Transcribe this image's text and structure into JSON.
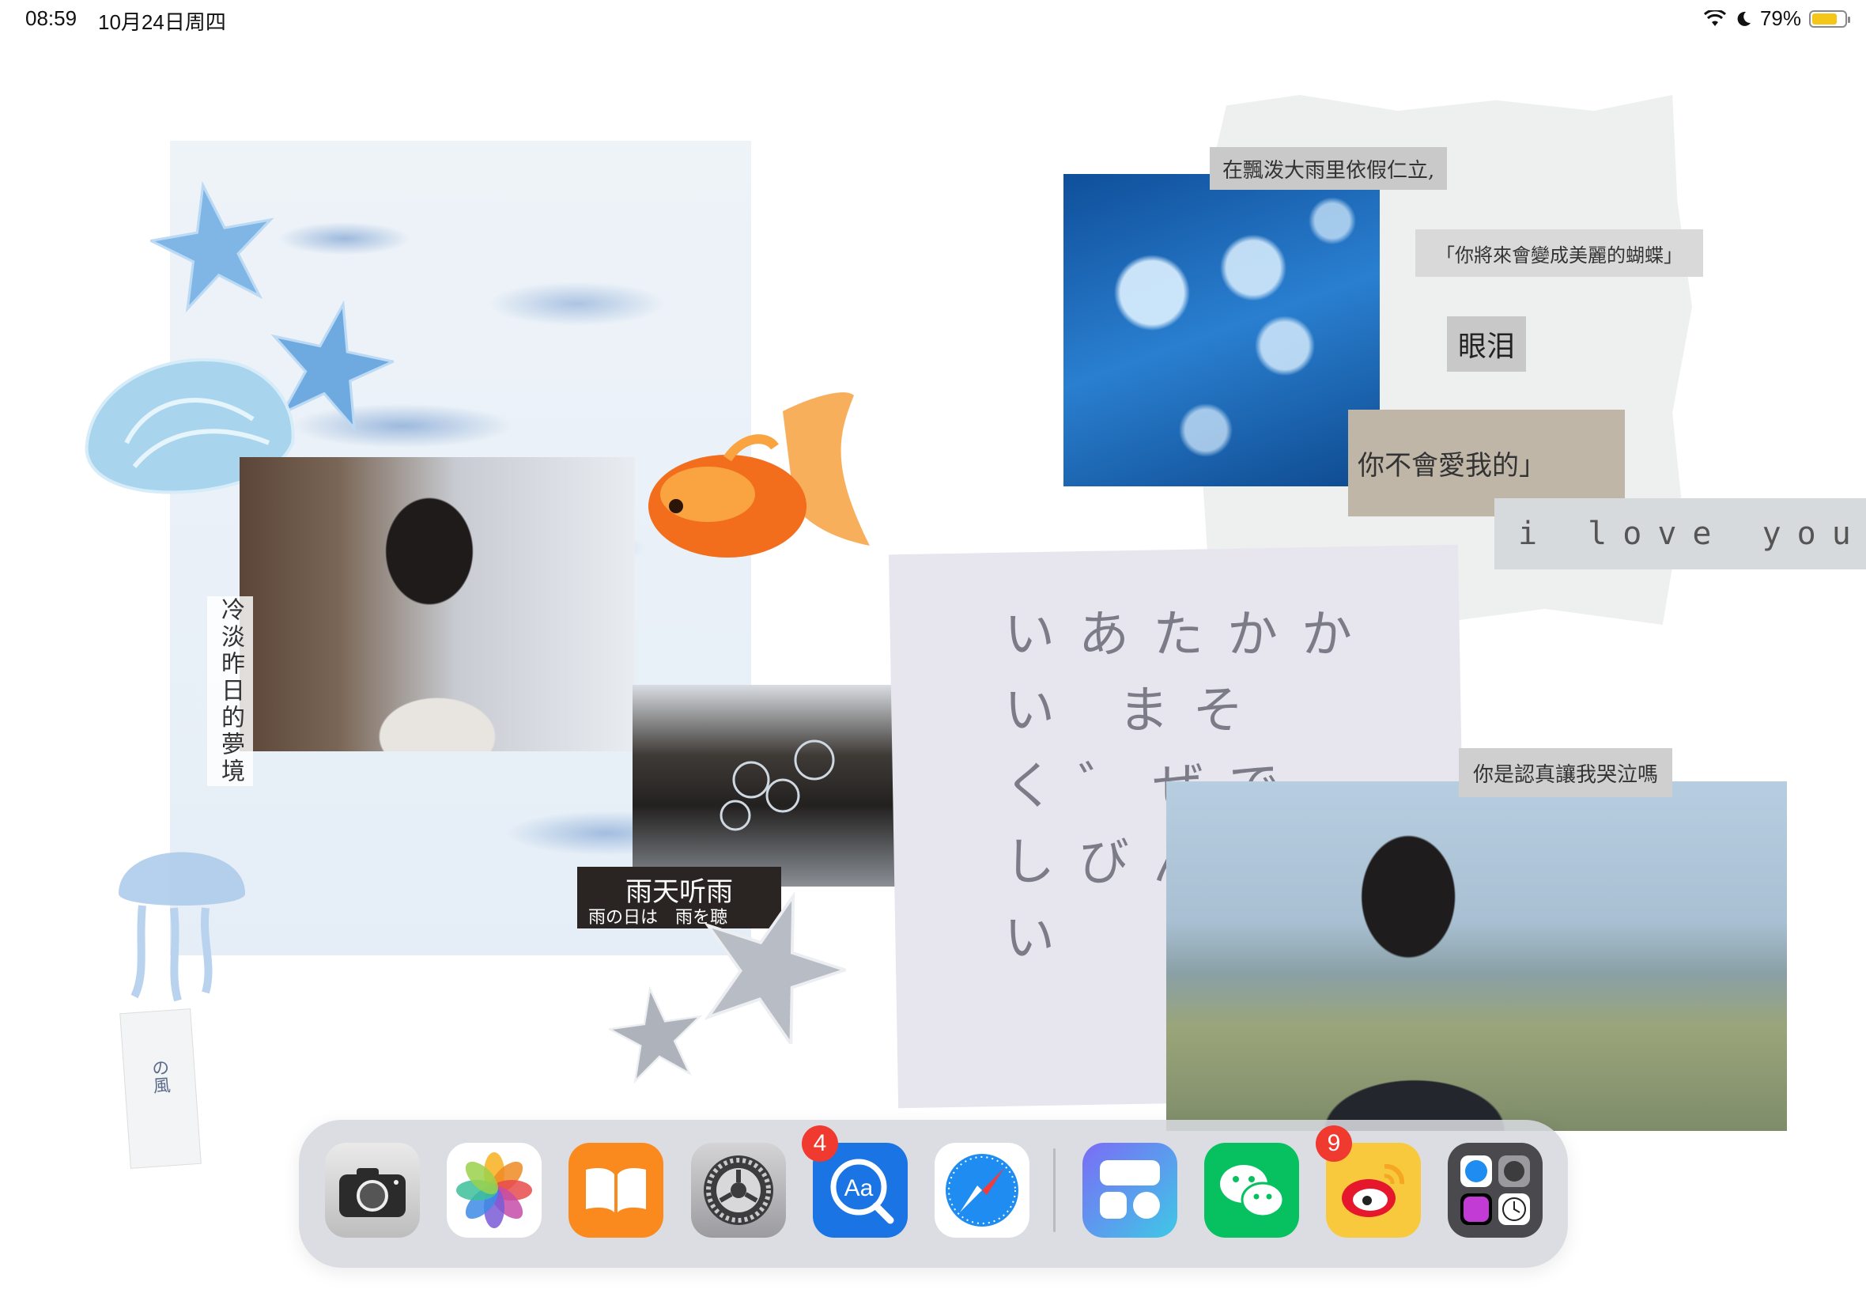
{
  "status_bar": {
    "time": "08:59",
    "date": "10月24日周四",
    "battery_percent_text": "79%",
    "battery_level": 0.79,
    "wifi_icon": "wifi-icon",
    "focus_icon": "moon-icon",
    "battery_color": "#f5c518"
  },
  "wallpaper": {
    "vertical_caption": "冷淡昨日的夢境",
    "rain_caption_title": "雨天听雨",
    "rain_caption_sub": "雨の日は　雨を聴",
    "strip_1": "在飄泼大雨里依假仁立,",
    "strip_2": "「你將來會變成美麗的蝴蝶」",
    "strip_3": "眼泪",
    "strip_4": "你不會愛我的」",
    "strip_5": "i love you",
    "strip_6": "你是認真讓我哭泣嗎",
    "sketch_text": "いあたかかい まそく゛ぜで しびんたがい",
    "tag_text": "の風"
  },
  "dock": {
    "apps": [
      {
        "name": "相机",
        "icon": "camera-icon"
      },
      {
        "name": "照片",
        "icon": "photos-icon"
      },
      {
        "name": "图书",
        "icon": "books-icon"
      },
      {
        "name": "设置",
        "icon": "settings-icon",
        "badge": "4"
      },
      {
        "name": "词典",
        "icon": "dictionary-icon"
      },
      {
        "name": "Safari浏览器",
        "icon": "safari-icon"
      },
      {
        "name": "小组件",
        "icon": "widget-icon"
      },
      {
        "name": "微信",
        "icon": "wechat-icon",
        "badge": "9"
      },
      {
        "name": "微博",
        "icon": "weibo-icon"
      },
      {
        "name": "App资源库",
        "icon": "app-library-icon"
      }
    ],
    "colors": {
      "books": "#fb8a1e",
      "dictionary": "#1a74e4",
      "wechat": "#07c160",
      "weibo": "#f8c93d",
      "badge": "#f0392f"
    }
  }
}
